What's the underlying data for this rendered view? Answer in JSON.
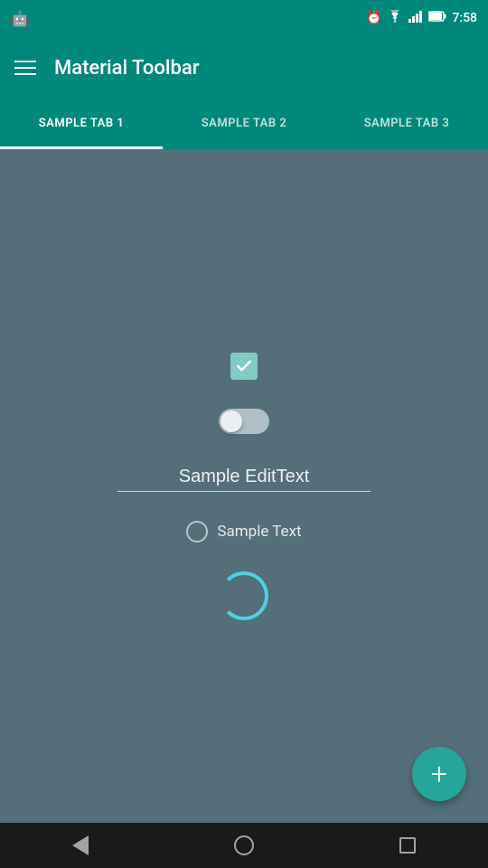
{
  "statusBar": {
    "time": "7:58",
    "androidLogo": "🤖"
  },
  "toolbar": {
    "title": "Material Toolbar",
    "menuIcon": "menu-icon"
  },
  "tabs": [
    {
      "id": "tab1",
      "label": "SAMPLE TAB 1",
      "active": true
    },
    {
      "id": "tab2",
      "label": "SAMPLE TAB 2",
      "active": false
    },
    {
      "id": "tab3",
      "label": "SAMPLE TAB 3",
      "active": false
    }
  ],
  "content": {
    "checkbox": {
      "checked": true,
      "label": "checkbox"
    },
    "toggle": {
      "on": false,
      "label": "toggle"
    },
    "edittext": {
      "value": "Sample EditText",
      "placeholder": "Sample EditText"
    },
    "radio": {
      "label": "Sample Text",
      "selected": false
    },
    "progress": {
      "label": "progress-indicator"
    },
    "fab": {
      "label": "+"
    }
  },
  "bottomNav": {
    "back": "back",
    "home": "home",
    "recents": "recents"
  },
  "colors": {
    "teal": "#00897b",
    "darkBlue": "#546e7a",
    "accent": "#26a69a"
  }
}
